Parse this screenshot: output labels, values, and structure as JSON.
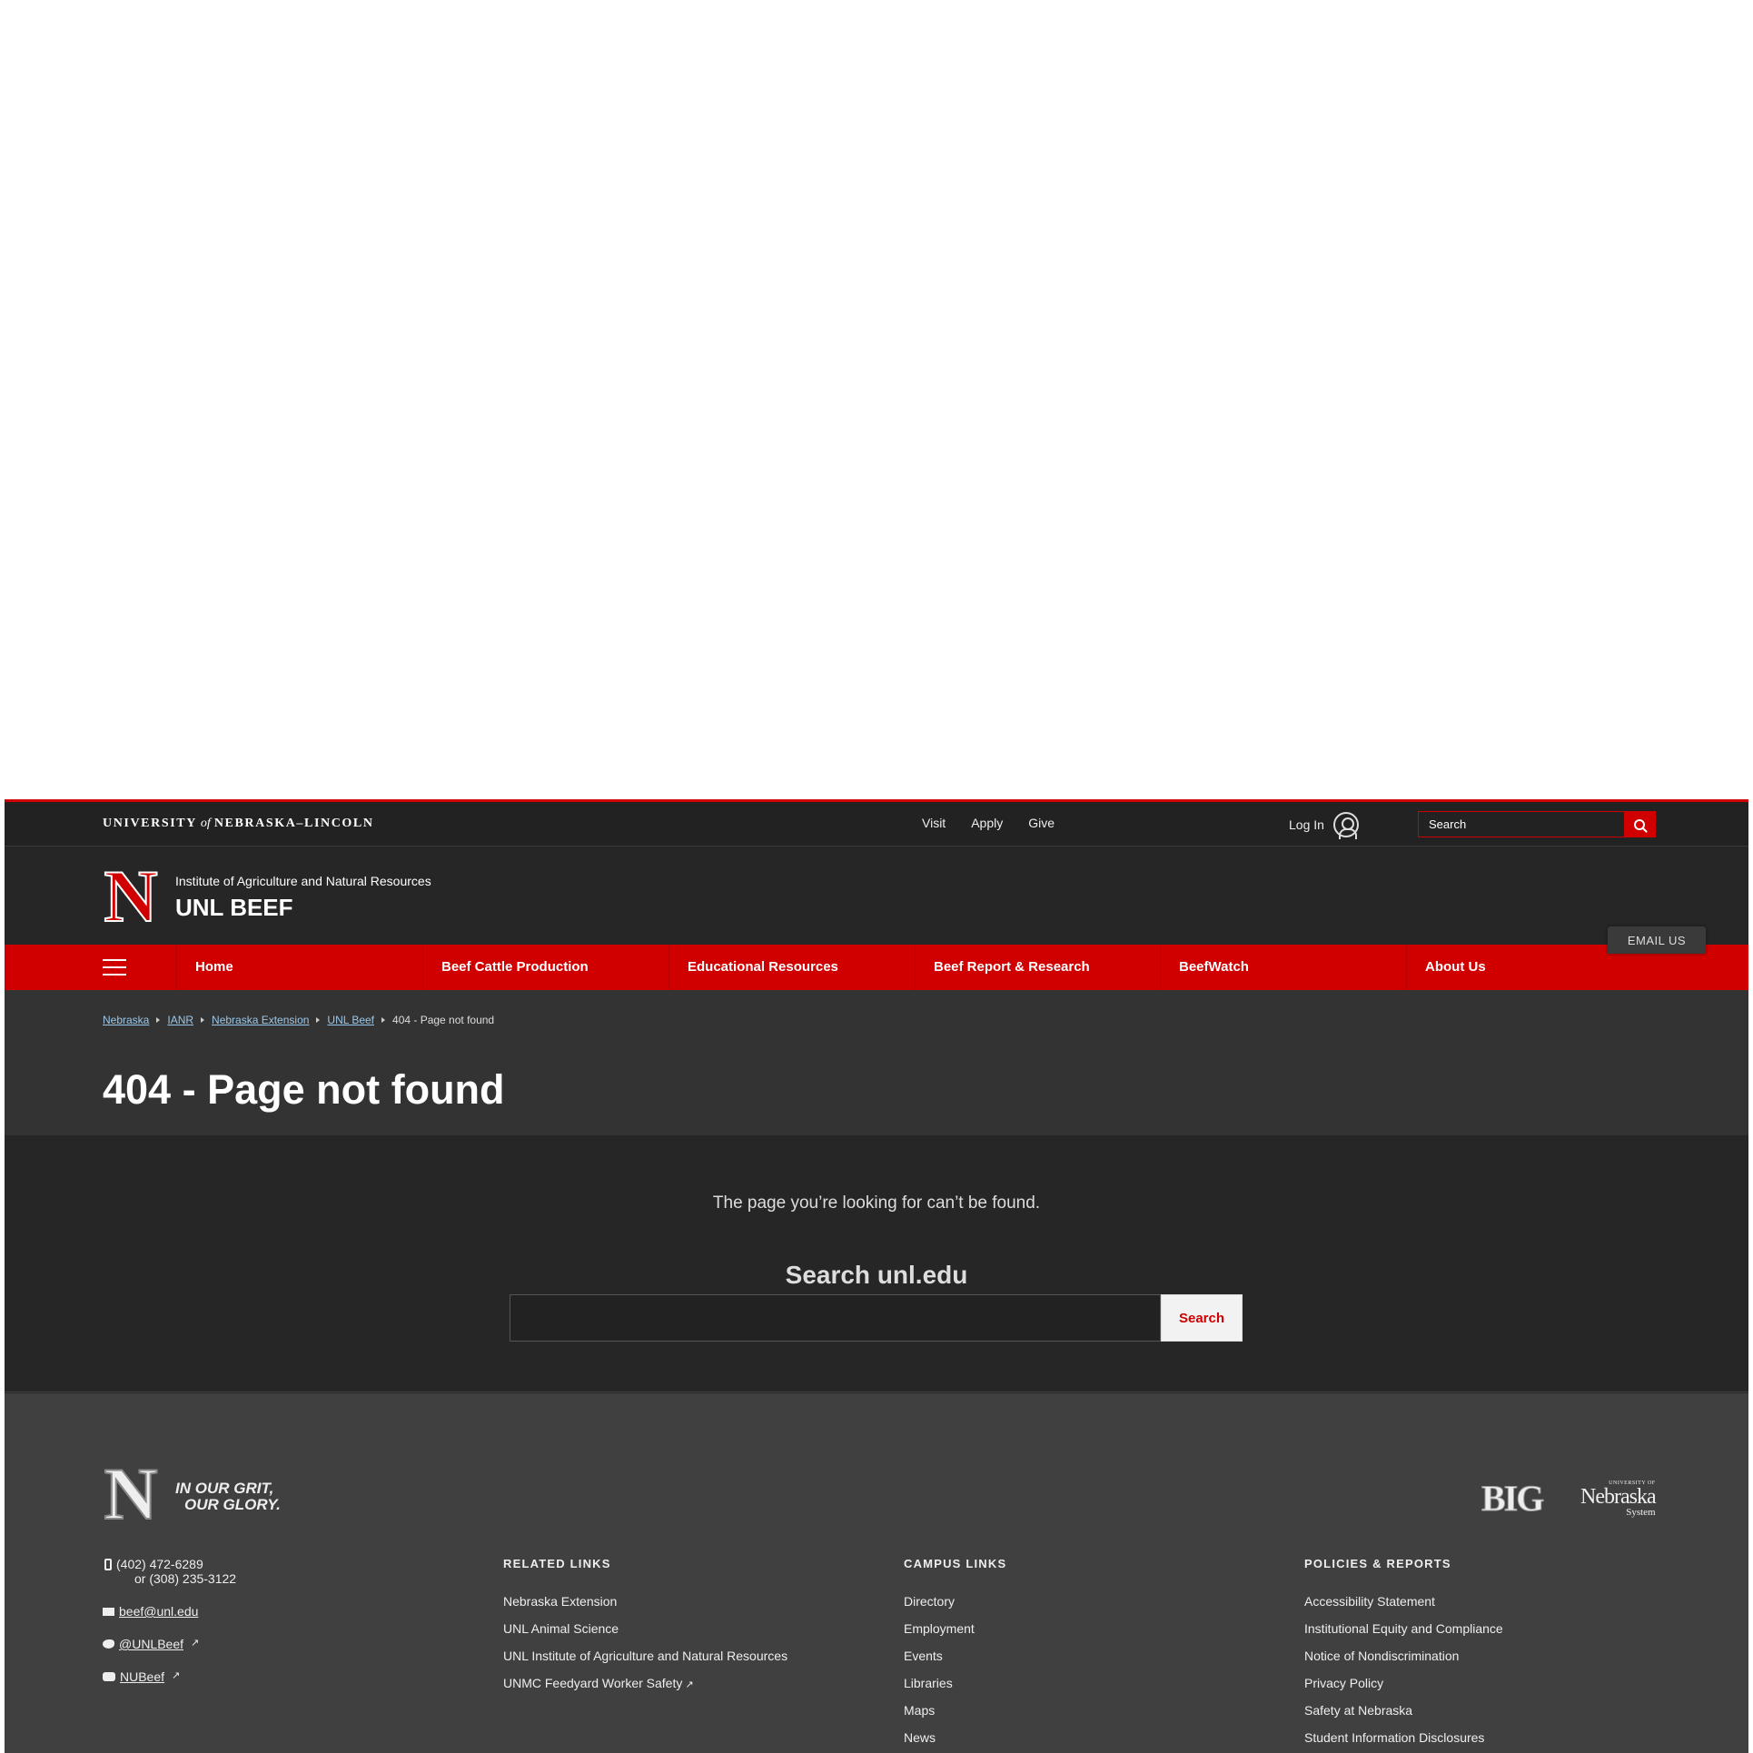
{
  "topbar": {
    "wordmark_left": "UNIVERSITY",
    "wordmark_of": "of",
    "wordmark_right": "NEBRASKA–LINCOLN",
    "links": [
      "Visit",
      "Apply",
      "Give"
    ],
    "login_label": "Log In",
    "search_placeholder": "Search"
  },
  "header": {
    "logo_letter": "N",
    "institute": "Institute of Agriculture and Natural Resources",
    "site_name": "UNL BEEF"
  },
  "nav": {
    "items": [
      "Home",
      "Beef Cattle Production",
      "Educational Resources",
      "Beef Report & Research",
      "BeefWatch",
      "About Us"
    ]
  },
  "breadcrumb": {
    "links": [
      "Nebraska",
      "IANR",
      "Nebraska Extension",
      "UNL Beef"
    ],
    "current": "404 - Page not found"
  },
  "page": {
    "title": "404 - Page not found",
    "message": "The page you’re looking for can’t be found.",
    "search_heading": "Search unl.edu",
    "search_button": "Search"
  },
  "footer": {
    "logo_letter": "N",
    "tagline_line1": "IN OUR GRIT,",
    "tagline_line2": "OUR GLORY.",
    "big10_text": "BIG",
    "nu_system_tiny": "UNIVERSITY OF",
    "nu_system_word": "Nebraska",
    "nu_system_sub": "System",
    "phone1": "(402) 472-6289",
    "phone2": "or (308) 235-3122",
    "email": "beef@unl.edu",
    "twitter": "@UNLBeef",
    "youtube": "NUBeef",
    "related_heading": "RELATED LINKS",
    "related_links": [
      "Nebraska Extension",
      "UNL Animal Science",
      "UNL Institute of Agriculture and Natural Resources",
      "UNMC Feedyard Worker Safety"
    ],
    "campus_heading": "CAMPUS LINKS",
    "campus_links": [
      "Directory",
      "Employment",
      "Events",
      "Libraries",
      "Maps",
      "News"
    ],
    "policies_heading": "POLICIES & REPORTS",
    "policies_links": [
      "Accessibility Statement",
      "Institutional Equity and Compliance",
      "Notice of Nondiscrimination",
      "Privacy Policy",
      "Safety at Nebraska",
      "Student Information Disclosures"
    ],
    "email_us": "EMAIL US"
  }
}
